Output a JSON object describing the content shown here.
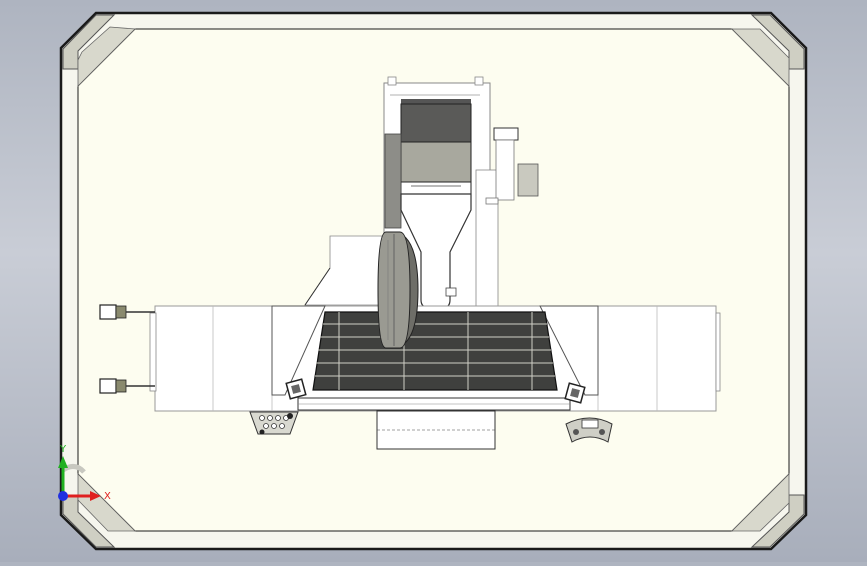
{
  "viewport": {
    "background_color": "#b8bdc8",
    "sheet_color": "#fdfdf0",
    "frame_color": "#f4f4ec",
    "corner_color": "#c9c9bd"
  },
  "triad": {
    "x_label": "X",
    "y_label": "Y",
    "x_color": "#e02020",
    "y_color": "#20b020",
    "origin_color": "#2030e0"
  },
  "model": {
    "name_hidden": true,
    "parts": [
      "column-carriage",
      "motor-housing",
      "spindle-head",
      "rotary-turntable",
      "worktable",
      "table-base",
      "left-connectors",
      "right-way-cover",
      "left-way-cover",
      "coolant-manifold",
      "support-foot"
    ]
  }
}
